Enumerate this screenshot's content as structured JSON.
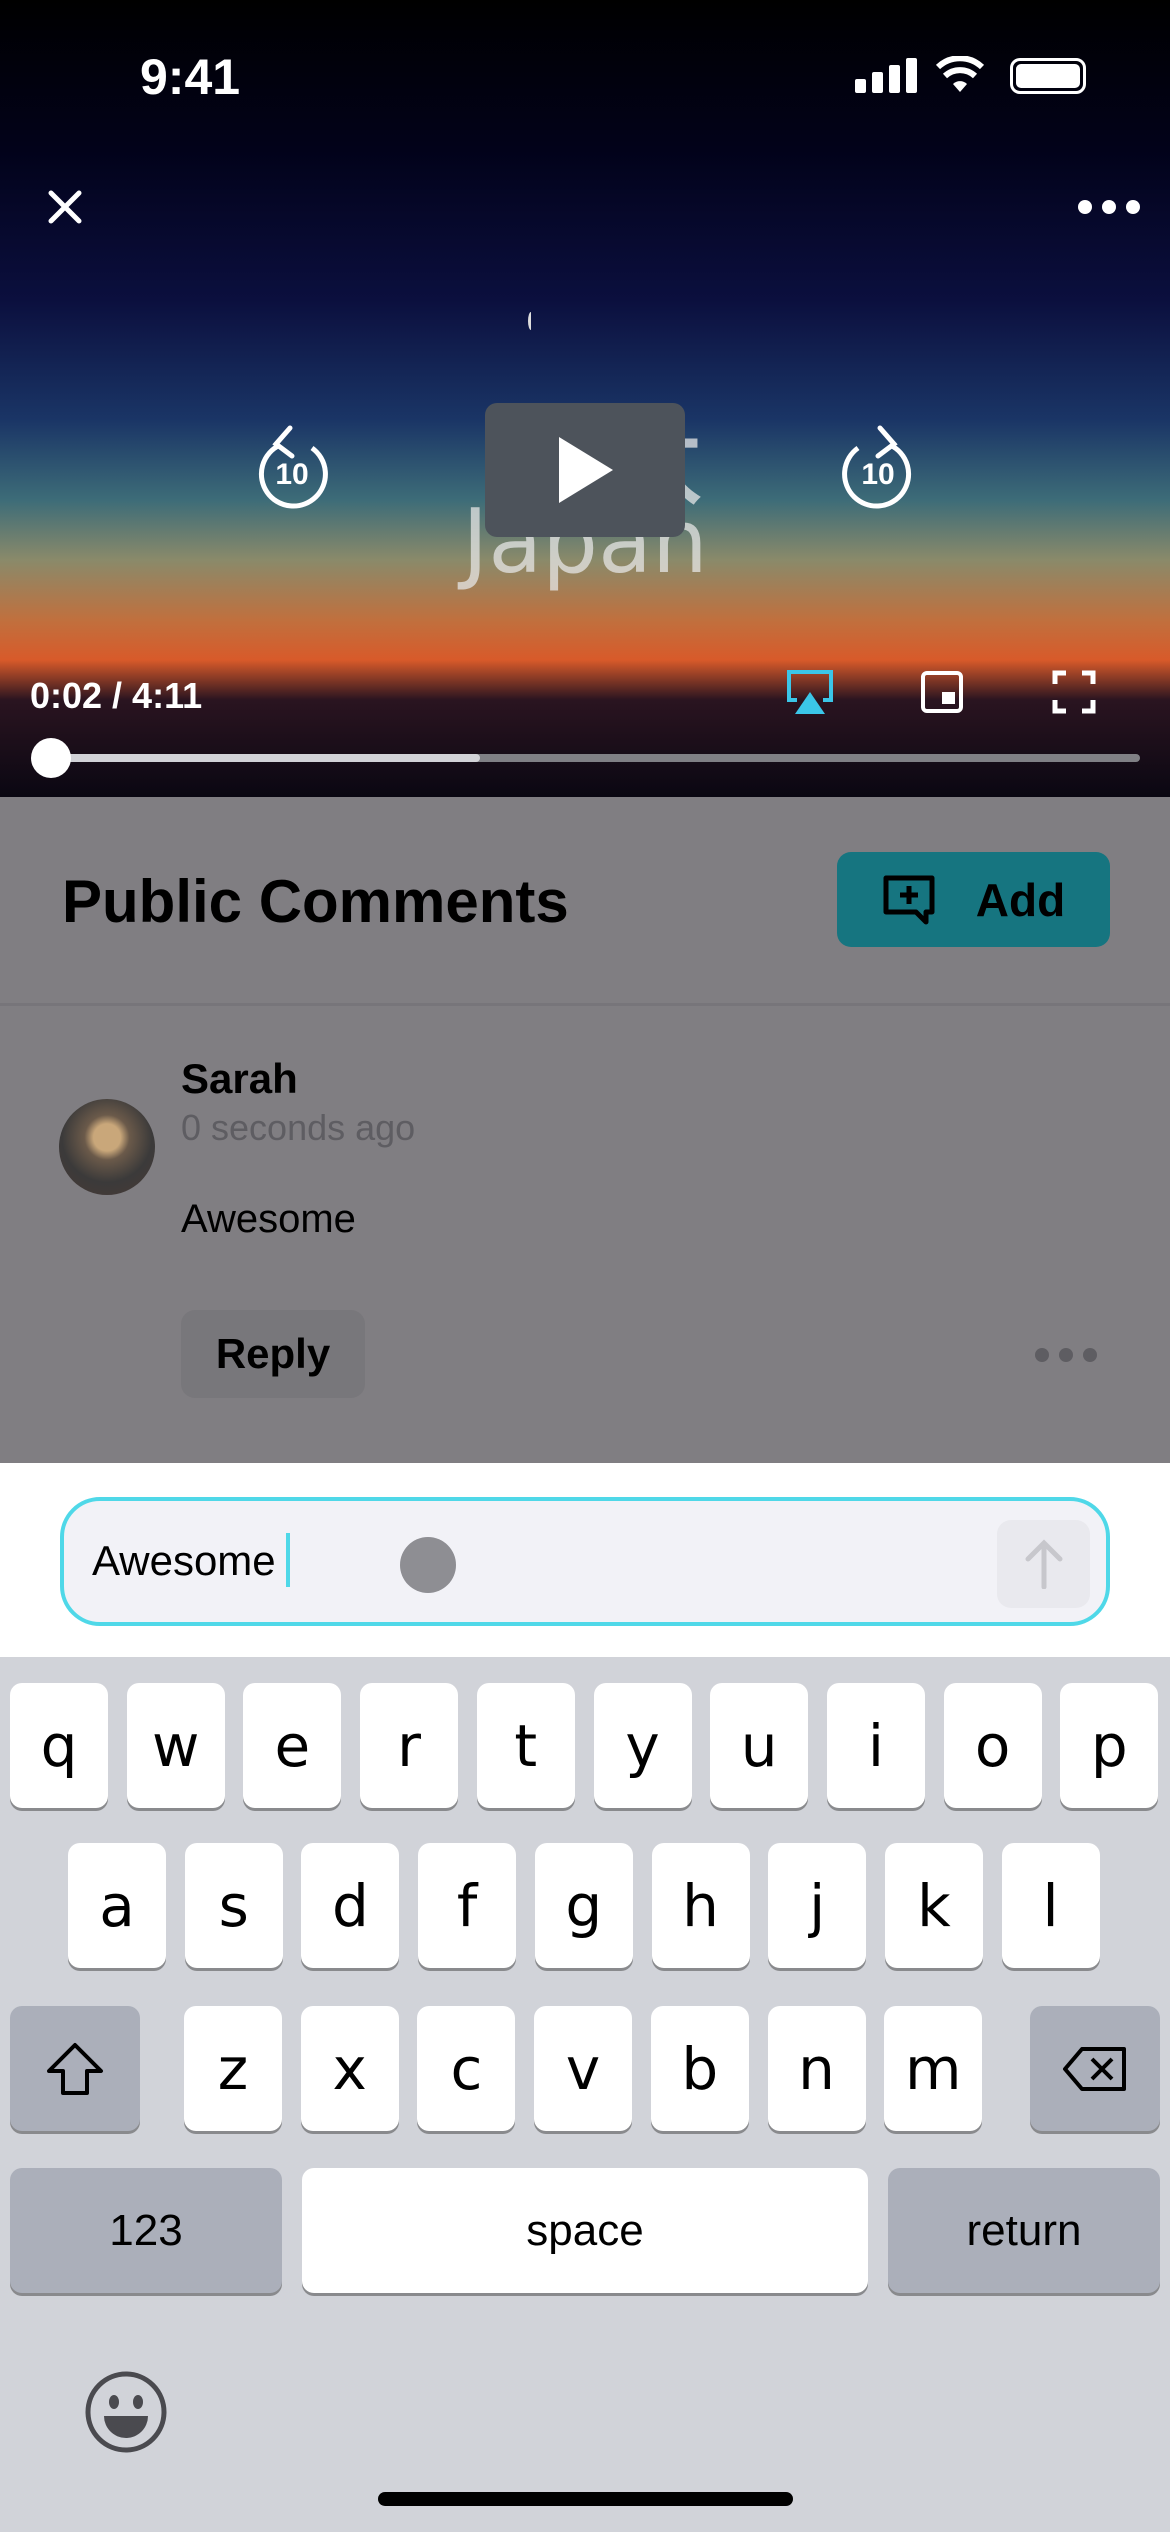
{
  "status_bar": {
    "time": "9:41"
  },
  "video": {
    "title_art": {
      "kanji": "日本",
      "english": "Japan"
    },
    "current_time": "0:02",
    "duration": "4:11",
    "time_display": "0:02 / 4:11",
    "progress_percent": 0.8,
    "buffered_percent": 40,
    "skip_back_seconds": "10",
    "skip_forward_seconds": "10",
    "airplay_active_color": "#3bc6e8"
  },
  "comments": {
    "header": "Public Comments",
    "add_label": "Add",
    "add_color": "#167580",
    "items": [
      {
        "author": "Sarah",
        "time": "0 seconds ago",
        "text": "Awesome",
        "reply_label": "Reply"
      }
    ]
  },
  "composer": {
    "value": "Awesome",
    "border_color": "#4fd8e8"
  },
  "keyboard": {
    "row1": [
      "q",
      "w",
      "e",
      "r",
      "t",
      "y",
      "u",
      "i",
      "o",
      "p"
    ],
    "row2": [
      "a",
      "s",
      "d",
      "f",
      "g",
      "h",
      "j",
      "k",
      "l"
    ],
    "row3": [
      "z",
      "x",
      "c",
      "v",
      "b",
      "n",
      "m"
    ],
    "numbers_label": "123",
    "space_label": "space",
    "return_label": "return"
  }
}
